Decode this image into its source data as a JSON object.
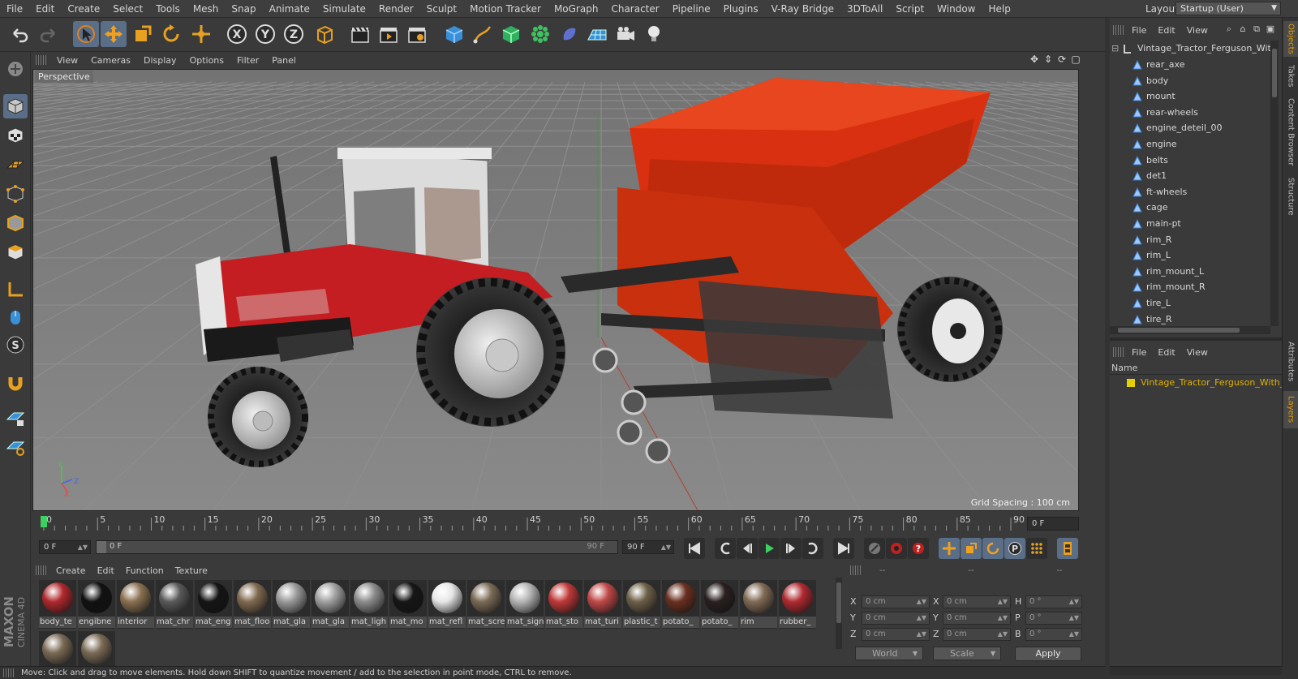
{
  "menu": [
    "File",
    "Edit",
    "Create",
    "Select",
    "Tools",
    "Mesh",
    "Snap",
    "Animate",
    "Simulate",
    "Render",
    "Sculpt",
    "Motion Tracker",
    "MoGraph",
    "Character",
    "Pipeline",
    "Plugins",
    "V-Ray Bridge",
    "3DToAll",
    "Script",
    "Window",
    "Help"
  ],
  "layout": {
    "label": "Layout:",
    "value": "Startup (User)"
  },
  "viewport": {
    "menu": [
      "View",
      "Cameras",
      "Display",
      "Options",
      "Filter",
      "Panel"
    ],
    "label": "Perspective",
    "grid_spacing": "Grid Spacing : 100 cm",
    "axis": {
      "y": "Y",
      "z": "Z",
      "x": "X"
    }
  },
  "timeline": {
    "ticks": [
      "0",
      "5",
      "10",
      "15",
      "20",
      "25",
      "30",
      "35",
      "40",
      "45",
      "50",
      "55",
      "60",
      "65",
      "70",
      "75",
      "80",
      "85",
      "90"
    ],
    "end_field": "0 F"
  },
  "transport": {
    "start_field": "0 F",
    "slider_left": "0 F",
    "slider_right": "90 F",
    "end_field": "90 F"
  },
  "materials": {
    "menu": [
      "Create",
      "Edit",
      "Function",
      "Texture"
    ],
    "items": [
      {
        "name": "body_te",
        "color": "#b0282c"
      },
      {
        "name": "engibne",
        "color": "#111111"
      },
      {
        "name": "interior",
        "color": "#8a7050"
      },
      {
        "name": "mat_chr",
        "color": "#5a5a5a"
      },
      {
        "name": "mat_eng",
        "color": "#151515"
      },
      {
        "name": "mat_floo",
        "color": "#806a50"
      },
      {
        "name": "mat_gla",
        "color": "#9a9a9a"
      },
      {
        "name": "mat_gla",
        "color": "#a0a0a0"
      },
      {
        "name": "mat_ligh",
        "color": "#8c8c8c"
      },
      {
        "name": "mat_mo",
        "color": "#161616"
      },
      {
        "name": "mat_refl",
        "color": "#e6e6e6"
      },
      {
        "name": "mat_scre",
        "color": "#7a6a55"
      },
      {
        "name": "mat_sign",
        "color": "#b4b4b4"
      },
      {
        "name": "mat_sto",
        "color": "#c03838"
      },
      {
        "name": "mat_turi",
        "color": "#c04848"
      },
      {
        "name": "plastic_t",
        "color": "#6e6048"
      },
      {
        "name": "potato_",
        "color": "#6a3020"
      },
      {
        "name": "potato_",
        "color": "#2a2020"
      },
      {
        "name": "rim",
        "color": "#806a55"
      },
      {
        "name": "rubber_",
        "color": "#b02a30"
      },
      {
        "name": "",
        "color": "#7a6a55"
      },
      {
        "name": "",
        "color": "#7a6a55"
      }
    ]
  },
  "coords": {
    "head_left": "--",
    "head_mid": "--",
    "head_right": "--",
    "rows": [
      {
        "a": "X",
        "av": "0 cm",
        "b": "X",
        "bv": "0 cm",
        "c": "H",
        "cv": "0 °"
      },
      {
        "a": "Y",
        "av": "0 cm",
        "b": "Y",
        "bv": "0 cm",
        "c": "P",
        "cv": "0 °"
      },
      {
        "a": "Z",
        "av": "0 cm",
        "b": "Z",
        "bv": "0 cm",
        "c": "B",
        "cv": "0 °"
      }
    ],
    "space": "World",
    "mode": "Scale",
    "apply": "Apply"
  },
  "status": "Move: Click and drag to move elements. Hold down SHIFT to quantize movement / add to the selection in point mode, CTRL to remove.",
  "objects": {
    "menu": [
      "File",
      "Edit",
      "View"
    ],
    "root": "Vintage_Tractor_Ferguson_With",
    "children": [
      "rear_axe",
      "body",
      "mount",
      "rear-wheels",
      "engine_deteil_00",
      "engine",
      "belts",
      "det1",
      "ft-wheels",
      "cage",
      "main-pt",
      "rim_R",
      "rim_L",
      "rim_mount_L",
      "rim_mount_R",
      "tire_L",
      "tire_R"
    ]
  },
  "layers": {
    "menu": [
      "File",
      "Edit",
      "View"
    ],
    "header": "Name",
    "row": "Vintage_Tractor_Ferguson_With_P"
  },
  "right_tabs": [
    "Objects",
    "Takes",
    "Content Browser",
    "Structure",
    "Attributes",
    "Layers"
  ],
  "brand": {
    "line1": "MAXON",
    "line2": "CINEMA 4D"
  }
}
